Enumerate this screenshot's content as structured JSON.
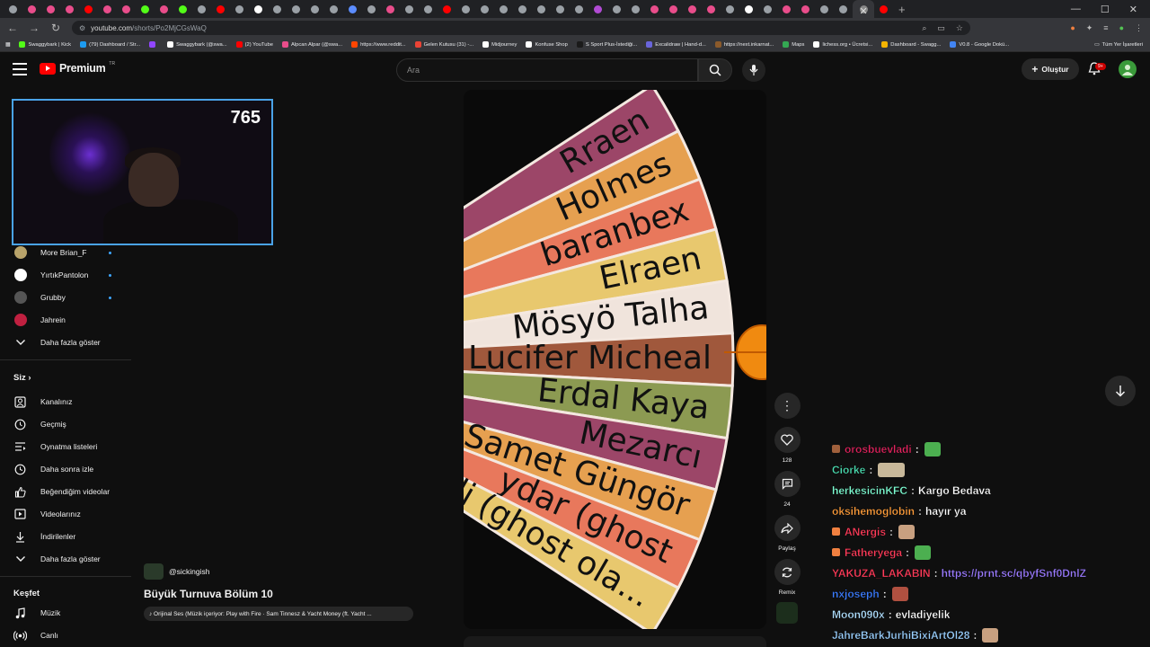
{
  "browser": {
    "tab_colors": [
      "#9aa0a6",
      "#e94d8b",
      "#e94d8b",
      "#e94d8b",
      "#ff0000",
      "#e94d8b",
      "#e94d8b",
      "#53fc18",
      "#e94d8b",
      "#53fc18",
      "#9aa0a6",
      "#ff0000",
      "#9aa0a6",
      "#ffffff",
      "#9aa0a6",
      "#9aa0a6",
      "#9aa0a6",
      "#9aa0a6",
      "#5b8cff",
      "#9aa0a6",
      "#e94d8b",
      "#9aa0a6",
      "#9aa0a6",
      "#ff0000",
      "#9aa0a6",
      "#9aa0a6",
      "#9aa0a6",
      "#9aa0a6",
      "#9aa0a6",
      "#9aa0a6",
      "#9aa0a6",
      "#b14bd4",
      "#9aa0a6",
      "#9aa0a6",
      "#e94d8b",
      "#e94d8b",
      "#e94d8b",
      "#e94d8b",
      "#9aa0a6",
      "#ffffff",
      "#9aa0a6",
      "#e94d8b",
      "#e94d8b",
      "#9aa0a6",
      "#9aa0a6",
      "#ff0000"
    ],
    "active_tab_close": "✕",
    "new_tab": "+",
    "url_host": "youtube.com",
    "url_path": "/shorts/Po2MjCGsWaQ"
  },
  "bookmarks": [
    {
      "label": "Swaggybark | Kick",
      "color": "#53fc18"
    },
    {
      "label": "(79) Dashboard / Str...",
      "color": "#1d9bf0"
    },
    {
      "label": "",
      "color": "#9146ff"
    },
    {
      "label": "Swaggybark (@swa...",
      "color": "#ffffff"
    },
    {
      "label": "(2) YouTube",
      "color": "#ff0000"
    },
    {
      "label": "Alpcan Alpar (@swa...",
      "color": "#e94d8b"
    },
    {
      "label": "https://www.reddit...",
      "color": "#ff4500"
    },
    {
      "label": "Gelen Kutusu (31) -...",
      "color": "#ea4335"
    },
    {
      "label": "Midjourney",
      "color": "#ffffff"
    },
    {
      "label": "Konfuse Shop",
      "color": "#ffffff"
    },
    {
      "label": "S Sport Plus-İstediği...",
      "color": "#1a1a1a"
    },
    {
      "label": "Excalidraw | Hand-d...",
      "color": "#6965db"
    },
    {
      "label": "https://next.inkarnat...",
      "color": "#8b5a2b"
    },
    {
      "label": "Maps",
      "color": "#34a853"
    },
    {
      "label": "lichess.org • Ücretsi...",
      "color": "#ffffff"
    },
    {
      "label": "Dashboard - Swagg...",
      "color": "#f4b400"
    },
    {
      "label": "V0.8 - Google Dokü...",
      "color": "#4285f4"
    }
  ],
  "bookmarks_all": "Tüm Yer İşaretleri",
  "header": {
    "logo_text": "Premium",
    "logo_region": "TR",
    "search_placeholder": "Ara",
    "create_label": "Oluştur",
    "notif_count": "9+"
  },
  "webcam": {
    "viewer_count": "765"
  },
  "sidebar": {
    "channels": [
      {
        "label": "More Brian_F",
        "color": "#b8a36a",
        "live": true
      },
      {
        "label": "YırtıkPantolon",
        "color": "#ffffff",
        "live": true
      },
      {
        "label": "Grubby",
        "color": "#555555",
        "live": true
      },
      {
        "label": "Jahrein",
        "color": "#c02040",
        "live": false
      }
    ],
    "show_more_1": "Daha fazla göster",
    "you_heading": "Siz",
    "you_items": [
      {
        "label": "Kanalınız",
        "icon": "channel-icon"
      },
      {
        "label": "Geçmiş",
        "icon": "history-icon"
      },
      {
        "label": "Oynatma listeleri",
        "icon": "playlist-icon"
      },
      {
        "label": "Daha sonra izle",
        "icon": "watch-later-icon"
      },
      {
        "label": "Beğendiğim videolar",
        "icon": "thumbs-up-icon"
      },
      {
        "label": "Videolarınız",
        "icon": "video-icon"
      },
      {
        "label": "İndirilenler",
        "icon": "download-icon"
      }
    ],
    "show_more_2": "Daha fazla göster",
    "explore_heading": "Keşfet",
    "explore_items": [
      {
        "label": "Müzik",
        "icon": "music-icon"
      },
      {
        "label": "Canlı",
        "icon": "live-icon"
      }
    ]
  },
  "short": {
    "wheel_names": [
      "Rraen",
      "Holmes",
      "baranbex",
      "Elraen",
      "Mösyö Talha",
      "Lucifer Micheal",
      "Erdal Kaya",
      "Mezarcı",
      "Samet Güngör",
      "ydar (ghost",
      "li (ghost ola..."
    ],
    "slice_colors": [
      "#9c4668",
      "#e6a050",
      "#e8785c",
      "#e8c86e",
      "#f0e4dc",
      "#a0583c",
      "#8c9a52",
      "#9c4668",
      "#e6a050",
      "#e8785c",
      "#e8c86e"
    ],
    "channel": "@sickingish",
    "title": "Büyük Turnuva Bölüm 10",
    "audio": "♪ Orijinal Ses (Müzik içeriyor: Play with Fire · Sam Tinnesz & Yacht Money (ft. Yacht ..."
  },
  "actions": {
    "likes": "128",
    "comments": "24",
    "share": "Paylaş",
    "remix": "Remix"
  },
  "chat": [
    {
      "user": "orosbuevladi",
      "color": "#e0245e",
      "badge": "#a0603c",
      "sep": ":",
      "msg": "",
      "emote": "#4caf50"
    },
    {
      "user": "Ciorke",
      "color": "#4ce0b3",
      "badge": "",
      "sep": ":",
      "msg": "",
      "emote": "#c8b89a"
    },
    {
      "user": "herkesicinKFC",
      "color": "#7fffd4",
      "badge": "",
      "sep": ":",
      "msg": "Kargo Bedava",
      "emote": ""
    },
    {
      "user": "oksihemoglobin",
      "color": "#ff9d3b",
      "badge": "",
      "sep": ":",
      "msg": "hayır ya",
      "emote": ""
    },
    {
      "user": "ANergis",
      "color": "#ff3c5a",
      "badge": "#f08040",
      "sep": ":",
      "msg": "",
      "emote": "#c8a080"
    },
    {
      "user": "Fatheryega",
      "color": "#ff3c5a",
      "badge": "#f08040",
      "sep": ":",
      "msg": "",
      "emote": "#4caf50"
    },
    {
      "user": "YAKUZA_LAKABIN",
      "color": "#ff3c5a",
      "badge": "",
      "sep": ":",
      "msg": "https://prnt.sc/qbyfSnf0DnlZ",
      "msg_color": "#9b7bff",
      "emote": ""
    },
    {
      "user": "nxjoseph",
      "color": "#3c7dff",
      "badge": "",
      "sep": ":",
      "msg": "",
      "emote": "#b05040"
    },
    {
      "user": "Moon090x",
      "color": "#b0e0ff",
      "badge": "",
      "sep": ":",
      "msg": "evladiyelik",
      "emote": ""
    },
    {
      "user": "JahreBarkJurhiBixiArtOl28",
      "color": "#9ad0ff",
      "badge": "",
      "sep": ":",
      "msg": "",
      "emote": "#c8a080"
    }
  ]
}
